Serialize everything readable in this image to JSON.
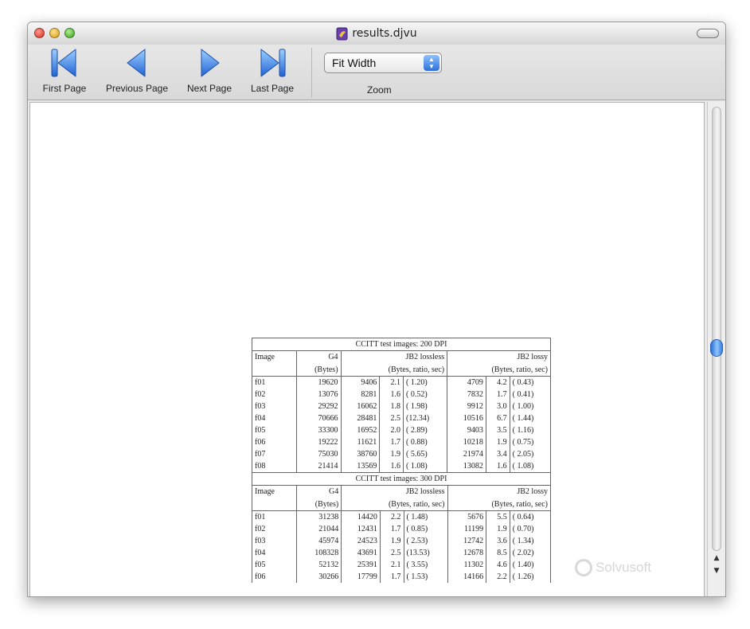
{
  "window": {
    "title": "results.djvu"
  },
  "toolbar": {
    "first_label": "First Page",
    "prev_label": "Previous Page",
    "next_label": "Next Page",
    "last_label": "Last Page",
    "zoom_value": "Fit Width",
    "zoom_label": "Zoom"
  },
  "icons": [
    "first-page-icon",
    "previous-page-icon",
    "next-page-icon",
    "last-page-icon",
    "document-icon"
  ],
  "colors": {
    "nav_blue": "#2f7be8",
    "scroll_thumb": "#3a7ee0"
  },
  "document": {
    "headers": {
      "image": "Image",
      "g4": "G4",
      "bytes": "(Bytes)",
      "jb2_lossless": "JB2 lossless",
      "jb2_lossy": "JB2 lossy",
      "brs": "(Bytes, ratio, sec)"
    },
    "tables": [
      {
        "caption": "CCITT test images: 200 DPI",
        "rows": [
          [
            "f01",
            "19620",
            "9406",
            "2.1",
            "( 1.20)",
            "4709",
            "4.2",
            "( 0.43)"
          ],
          [
            "f02",
            "13076",
            "8281",
            "1.6",
            "( 0.52)",
            "7832",
            "1.7",
            "( 0.41)"
          ],
          [
            "f03",
            "29292",
            "16062",
            "1.8",
            "( 1.98)",
            "9912",
            "3.0",
            "( 1.00)"
          ],
          [
            "f04",
            "70666",
            "28481",
            "2.5",
            "(12.34)",
            "10516",
            "6.7",
            "( 1.44)"
          ],
          [
            "f05",
            "33300",
            "16952",
            "2.0",
            "( 2.89)",
            "9403",
            "3.5",
            "( 1.16)"
          ],
          [
            "f06",
            "19222",
            "11621",
            "1.7",
            "( 0.88)",
            "10218",
            "1.9",
            "( 0.75)"
          ],
          [
            "f07",
            "75030",
            "38760",
            "1.9",
            "( 5.65)",
            "21974",
            "3.4",
            "( 2.05)"
          ],
          [
            "f08",
            "21414",
            "13569",
            "1.6",
            "( 1.08)",
            "13082",
            "1.6",
            "( 1.08)"
          ]
        ]
      },
      {
        "caption": "CCITT test images: 300 DPI",
        "rows": [
          [
            "f01",
            "31238",
            "14420",
            "2.2",
            "( 1.48)",
            "5676",
            "5.5",
            "( 0.64)"
          ],
          [
            "f02",
            "21044",
            "12431",
            "1.7",
            "( 0.85)",
            "11199",
            "1.9",
            "( 0.70)"
          ],
          [
            "f03",
            "45974",
            "24523",
            "1.9",
            "( 2.53)",
            "12742",
            "3.6",
            "( 1.34)"
          ],
          [
            "f04",
            "108328",
            "43691",
            "2.5",
            "(13.53)",
            "12678",
            "8.5",
            "( 2.02)"
          ],
          [
            "f05",
            "52132",
            "25391",
            "2.1",
            "( 3.55)",
            "11302",
            "4.6",
            "( 1.40)"
          ],
          [
            "f06",
            "30266",
            "17799",
            "1.7",
            "( 1.53)",
            "14166",
            "2.2",
            "( 1.26)"
          ]
        ]
      }
    ]
  },
  "watermark": "Solvusoft"
}
